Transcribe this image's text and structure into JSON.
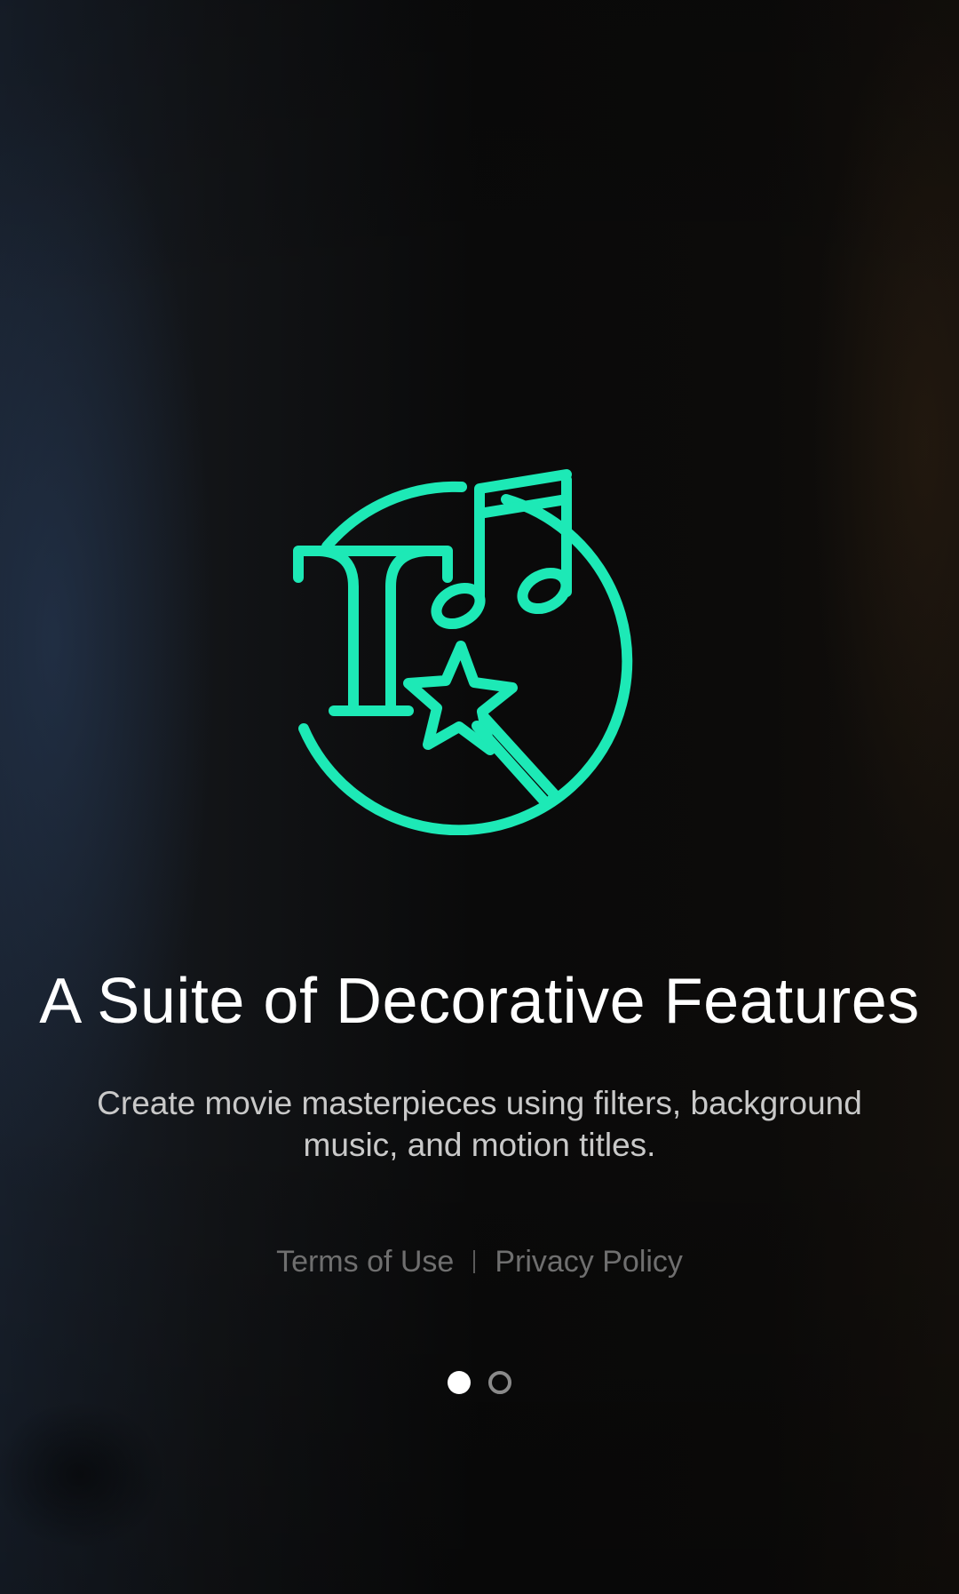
{
  "onboarding": {
    "hero_icon": "text-music-magic-wand-icon",
    "title": "A Suite of Decorative Features",
    "subtitle": "Create movie masterpieces using filters, background music, and motion titles.",
    "legal": {
      "terms_label": "Terms of Use",
      "privacy_label": "Privacy Policy"
    },
    "pagination": {
      "current_page": 1,
      "total_pages": 2
    }
  },
  "colors": {
    "accent": "#1de9b6",
    "title_text": "#ffffff",
    "subtitle_text": "#c9c9c9",
    "link_text": "#6f6f6f",
    "background": "#0d0d0d"
  }
}
